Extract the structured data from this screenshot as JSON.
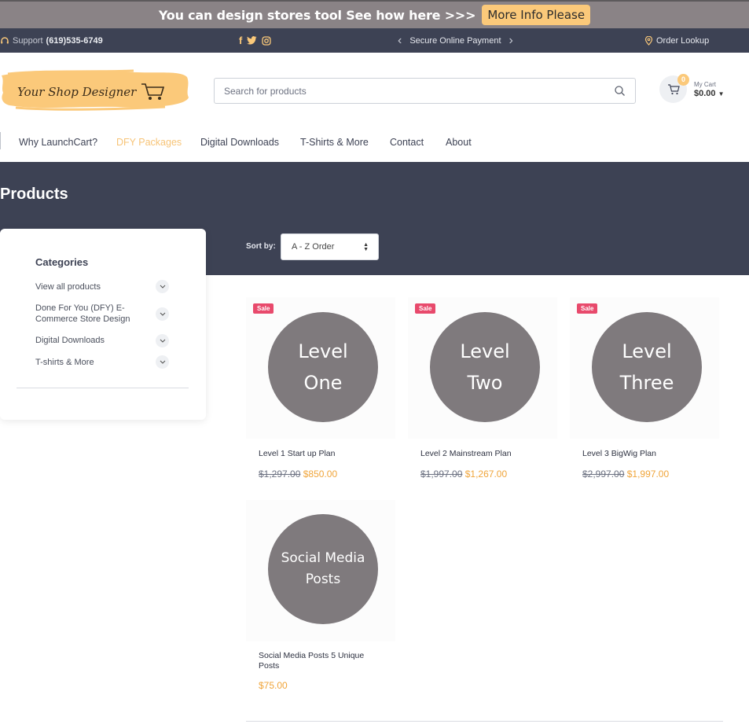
{
  "promo": {
    "text": "You can design stores tool See how here >>>",
    "button": "More Info Please"
  },
  "topbar": {
    "support_label": "Support",
    "phone": "(619)535-6749",
    "social": [
      "facebook-icon",
      "twitter-icon",
      "instagram-icon"
    ],
    "secure_text": "Secure Online Payment",
    "order_lookup": "Order Lookup"
  },
  "header": {
    "logo_text": "Your Shop Designer",
    "search_placeholder": "Search for products",
    "cart_count": "0",
    "cart_label": "My Cart",
    "cart_total": "$0.00"
  },
  "nav": {
    "items": [
      "Why LaunchCart?",
      "DFY Packages",
      "Digital Downloads",
      "T-Shirts & More",
      "Contact",
      "About"
    ],
    "active": "DFY Packages"
  },
  "hero": {
    "title": "Products",
    "sort_label": "Sort by:",
    "sort_value": "A - Z Order"
  },
  "sidebar": {
    "title": "Categories",
    "items": [
      {
        "label": "View all products"
      },
      {
        "label": "Done For You (DFY) E-Commerce Store Design"
      },
      {
        "label": "Digital Downloads"
      },
      {
        "label": "T-shirts & More"
      }
    ]
  },
  "products": [
    {
      "badge": "Sale",
      "image_line1": "Level",
      "image_line2": "One",
      "name": "Level 1 Start up Plan",
      "old_price": "$1,297.00",
      "price": "$850.00"
    },
    {
      "badge": "Sale",
      "image_line1": "Level",
      "image_line2": "Two",
      "name": "Level 2 Mainstream Plan",
      "old_price": "$1,997.00",
      "price": "$1,267.00"
    },
    {
      "badge": "Sale",
      "image_line1": "Level",
      "image_line2": "Three",
      "name": "Level 3 BigWig Plan",
      "old_price": "$2,997.00",
      "price": "$1,997.00"
    },
    {
      "badge": "",
      "image_line1": "Social Media",
      "image_line2": "Posts",
      "name": "Social Media Posts 5 Unique Posts",
      "old_price": "",
      "price": "$75.00"
    }
  ],
  "colors": {
    "accent": "#fbc97a",
    "dark": "#3d4254",
    "sale": "#e84a6c",
    "price": "#f0a53a",
    "promo_bg": "#8a8386"
  }
}
